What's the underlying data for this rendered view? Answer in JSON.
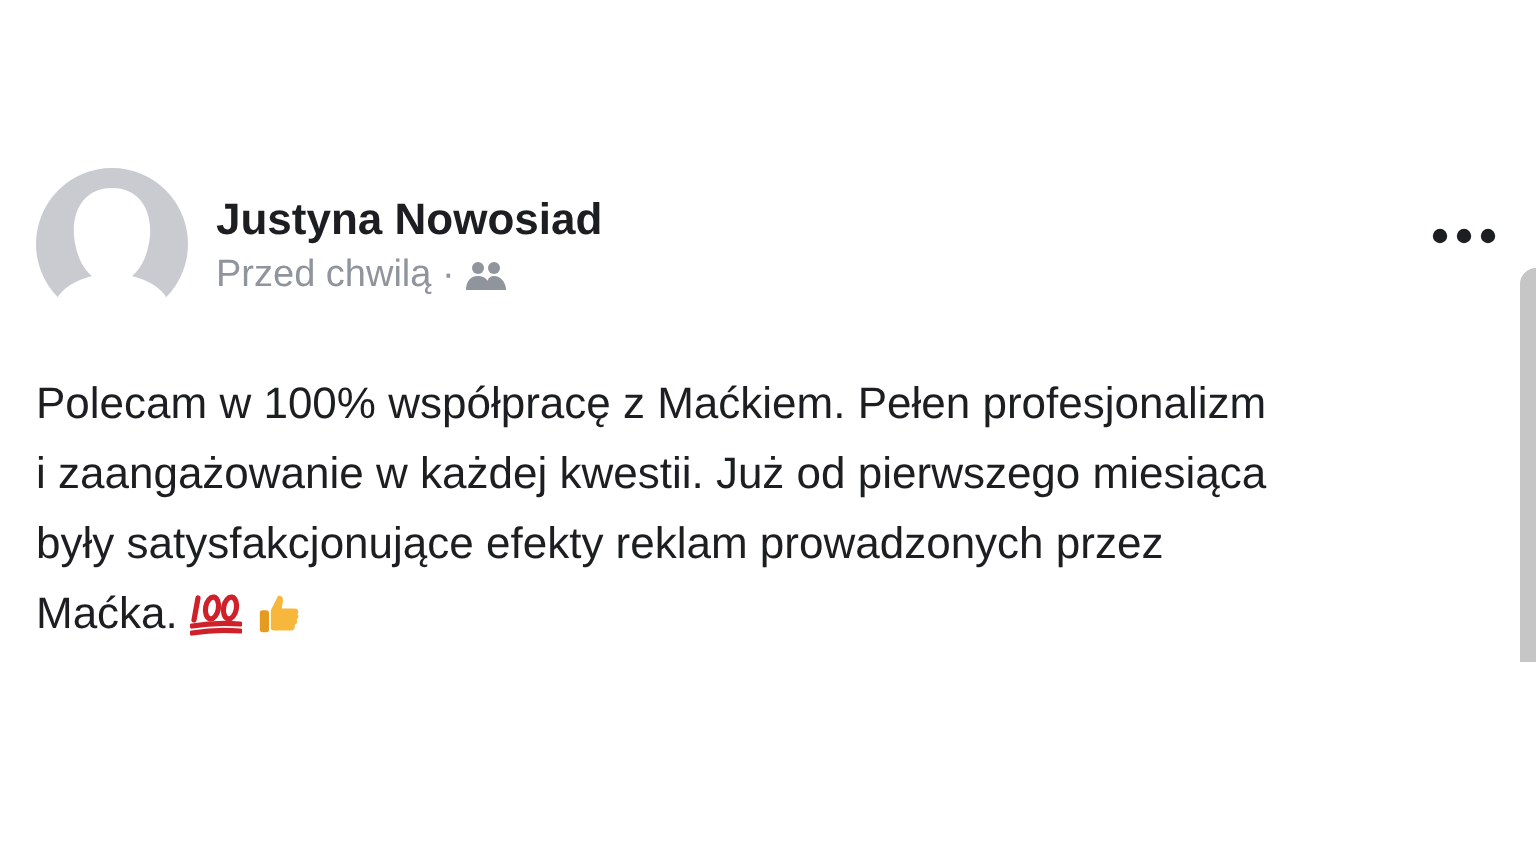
{
  "post": {
    "author": "Justyna Nowosiad",
    "time": "Przed chwilą ·",
    "lines": [
      "Polecam w 100% współpracę z Maćkiem. Pełen profesjonalizm",
      "i zaangażowanie w każdej kwestii. Już od pierwszego miesiąca",
      "były satysfakcjonujące efekty reklam prowadzonych przez",
      "Maćka."
    ]
  }
}
